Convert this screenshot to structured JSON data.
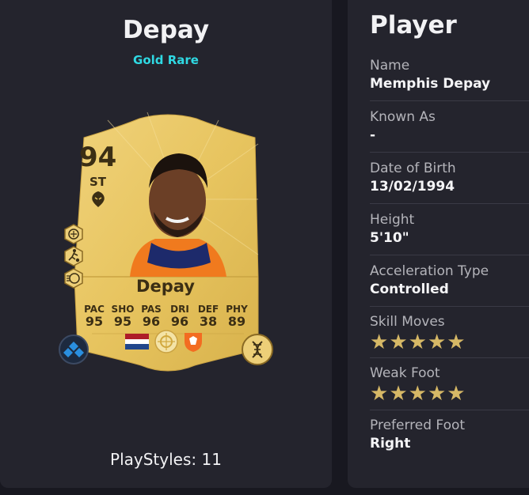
{
  "card": {
    "title": "Depay",
    "rarity": "Gold Rare",
    "rating": "94",
    "position": "ST",
    "name": "Depay",
    "stats": [
      {
        "label": "PAC",
        "value": "95"
      },
      {
        "label": "SHO",
        "value": "95"
      },
      {
        "label": "PAS",
        "value": "96"
      },
      {
        "label": "DRI",
        "value": "96"
      },
      {
        "label": "DEF",
        "value": "38"
      },
      {
        "label": "PHY",
        "value": "89"
      }
    ],
    "playstyles": "PlayStyles: 11",
    "colors": {
      "gold": "#e6c35a",
      "rarity_text": "#2fd9e3"
    }
  },
  "details": {
    "section_title": "Player",
    "rows": [
      {
        "label": "Name",
        "value": "Memphis Depay"
      },
      {
        "label": "Known As",
        "value": "-"
      },
      {
        "label": "Date of Birth",
        "value": "13/02/1994"
      },
      {
        "label": "Height",
        "value": "5'10\""
      },
      {
        "label": "Acceleration Type",
        "value": "Controlled"
      }
    ],
    "skill_moves": {
      "label": "Skill Moves",
      "stars": 5
    },
    "weak_foot": {
      "label": "Weak Foot",
      "stars": 5
    },
    "preferred_foot": {
      "label": "Preferred Foot",
      "value": "Right"
    }
  }
}
